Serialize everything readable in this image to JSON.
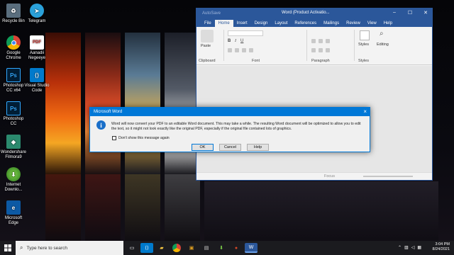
{
  "desktop": {
    "icons": [
      {
        "label": "Recycle Bin",
        "icon": "recycle-bin-icon",
        "color": "#5a6e7e"
      },
      {
        "label": "Telegram",
        "icon": "telegram-icon",
        "color": "#2aa1da"
      },
      {
        "label": "Google Chrome",
        "icon": "chrome-icon",
        "color": "#db4437"
      },
      {
        "label": "Aanadii Negeeye",
        "icon": "pdf-icon",
        "color": "#c4302b"
      },
      {
        "label": "Photoshop CC x64",
        "icon": "photoshop-icon",
        "color": "#001e36"
      },
      {
        "label": "Visual Studio Code",
        "icon": "vscode-icon",
        "color": "#007acc"
      },
      {
        "label": "Photoshop CC",
        "icon": "photoshop-icon",
        "color": "#001e36"
      },
      {
        "label": "Wondershare Filmora9",
        "icon": "filmora-icon",
        "color": "#2b8a6e"
      },
      {
        "label": "Internet Downlo...",
        "icon": "idm-icon",
        "color": "#3c8d2f"
      },
      {
        "label": "Microsoft Edge",
        "icon": "edge-icon",
        "color": "#0c59a4"
      }
    ]
  },
  "word": {
    "autosave": "AutoSave",
    "title": "Word (Product Activatio...",
    "tabs": [
      "File",
      "Home",
      "Insert",
      "Design",
      "Layout",
      "References",
      "Mailings",
      "Review",
      "View",
      "Help"
    ],
    "groups": {
      "paste": "Paste",
      "clipboard": "Clipboard",
      "font": "Font",
      "paragraph": "Paragraph",
      "styles_btn": "Styles",
      "editing_btn": "Editing",
      "styles": "Styles"
    },
    "status_focus": "Focus",
    "accent": "#2b579a"
  },
  "dialog": {
    "title": "Microsoft Word",
    "message": "Word will now convert your PDF to an editable Word document. This may take a while. The resulting Word document will be optimized to allow you to edit the text, so it might not look exactly like the original PDF, especially if the original file contained lots of graphics.",
    "checkbox_label": "Don't show this message again",
    "ok": "OK",
    "cancel": "Cancel",
    "help": "Help"
  },
  "taskbar": {
    "search_placeholder": "Type here to search",
    "time": "3:04 PM",
    "date": "8/24/2021"
  }
}
